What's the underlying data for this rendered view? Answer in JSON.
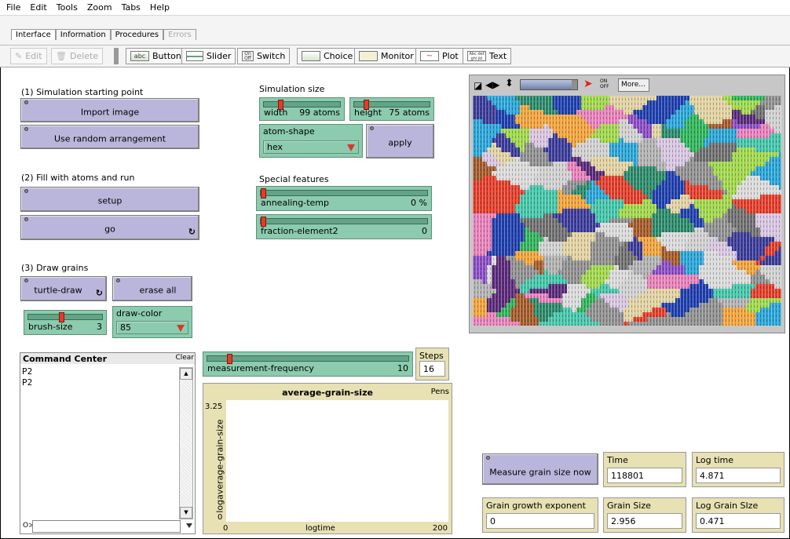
{
  "menu": [
    "File",
    "Edit",
    "Tools",
    "Zoom",
    "Tabs",
    "Help"
  ],
  "tabs": [
    {
      "label": "Interface",
      "active": true,
      "disabled": false
    },
    {
      "label": "Information",
      "active": false,
      "disabled": false
    },
    {
      "label": "Procedures",
      "active": false,
      "disabled": false
    },
    {
      "label": "Errors",
      "active": false,
      "disabled": true
    }
  ],
  "toolbar": {
    "edit": "Edit",
    "delete": "Delete",
    "button": "Button",
    "slider": "Slider",
    "switch": "Switch",
    "choice": "Choice",
    "monitor": "Monitor",
    "plot": "Plot",
    "text": "Text",
    "icon_text_abc": "abc",
    "icon_text_def": "Abc def ghi jkl",
    "icon_on": "On",
    "icon_off": "Off"
  },
  "sections": {
    "start": "(1) Simulation starting point",
    "fill": "(2) Fill with atoms and run",
    "draw": "(3) Draw grains",
    "size": "Simulation size",
    "special": "Special features"
  },
  "buttons": {
    "import_image": "Import image",
    "random": "Use random arrangement",
    "setup": "setup",
    "go": "go",
    "turtle_draw": "turtle-draw",
    "erase_all": "erase all",
    "apply": "apply",
    "measure": "Measure grain size now",
    "forever_glyph": "↻"
  },
  "sliders": {
    "width": {
      "name": "width",
      "value": "99 atoms",
      "fraction": 0.2
    },
    "height": {
      "name": "height",
      "value": "75 atoms",
      "fraction": 0.14
    },
    "annealing": {
      "name": "annealing-temp",
      "value": "0 %",
      "fraction": 0.0
    },
    "fraction2": {
      "name": "fraction-element2",
      "value": "0",
      "fraction": 0.0
    },
    "brush": {
      "name": "brush-size",
      "value": "3",
      "fraction": 0.45
    },
    "measurement": {
      "name": "measurement-frequency",
      "value": "10",
      "fraction": 0.1
    }
  },
  "choosers": {
    "atom_shape": {
      "name": "atom-shape",
      "value": "hex"
    },
    "draw_color": {
      "name": "draw-color",
      "value": "85"
    }
  },
  "monitors": {
    "steps": {
      "name": "Steps",
      "value": "16"
    },
    "time": {
      "name": "Time",
      "value": "118801"
    },
    "log_time": {
      "name": "Log time",
      "value": "4.871"
    },
    "exponent": {
      "name": "Grain growth exponent",
      "value": "0"
    },
    "grain_size": {
      "name": "Grain Size",
      "value": "2.956"
    },
    "log_grain_size": {
      "name": "Log Grain SIze",
      "value": "0.471"
    }
  },
  "command_center": {
    "title": "Command Center",
    "clear": "Clear",
    "lines": [
      "P2",
      "P2"
    ],
    "prompt": "O>",
    "input": ""
  },
  "plot": {
    "title": "average-grain-size",
    "pens": "Pens",
    "ylabel": "logaverage-grain-size",
    "xlabel": "logtime",
    "ymax": "3.25",
    "ymin": "0",
    "xmin": "0",
    "xmax": "200"
  },
  "chart_data": {
    "type": "line",
    "title": "average-grain-size",
    "xlabel": "logtime",
    "ylabel": "logaverage-grain-size",
    "xlim": [
      0,
      200
    ],
    "ylim": [
      0,
      3.25
    ],
    "series": []
  },
  "view": {
    "speed_fraction": 0.9,
    "more": "More...",
    "on": "ON",
    "off": "OFF",
    "palette": [
      "#1f3fae",
      "#29a4d6",
      "#2fb35a",
      "#e23d2a",
      "#e67fb9",
      "#f0a23a",
      "#8a4cc4",
      "#6f6f6f",
      "#cfcfcf",
      "#2b8a6a",
      "#a35a2a",
      "#d6c4e0",
      "#3b3b9a",
      "#9fd64a",
      "#d9d9d9",
      "#8f8f8f",
      "#5a2a7a",
      "#b0b0b0",
      "#e0d1a0",
      "#43c4a8"
    ]
  }
}
